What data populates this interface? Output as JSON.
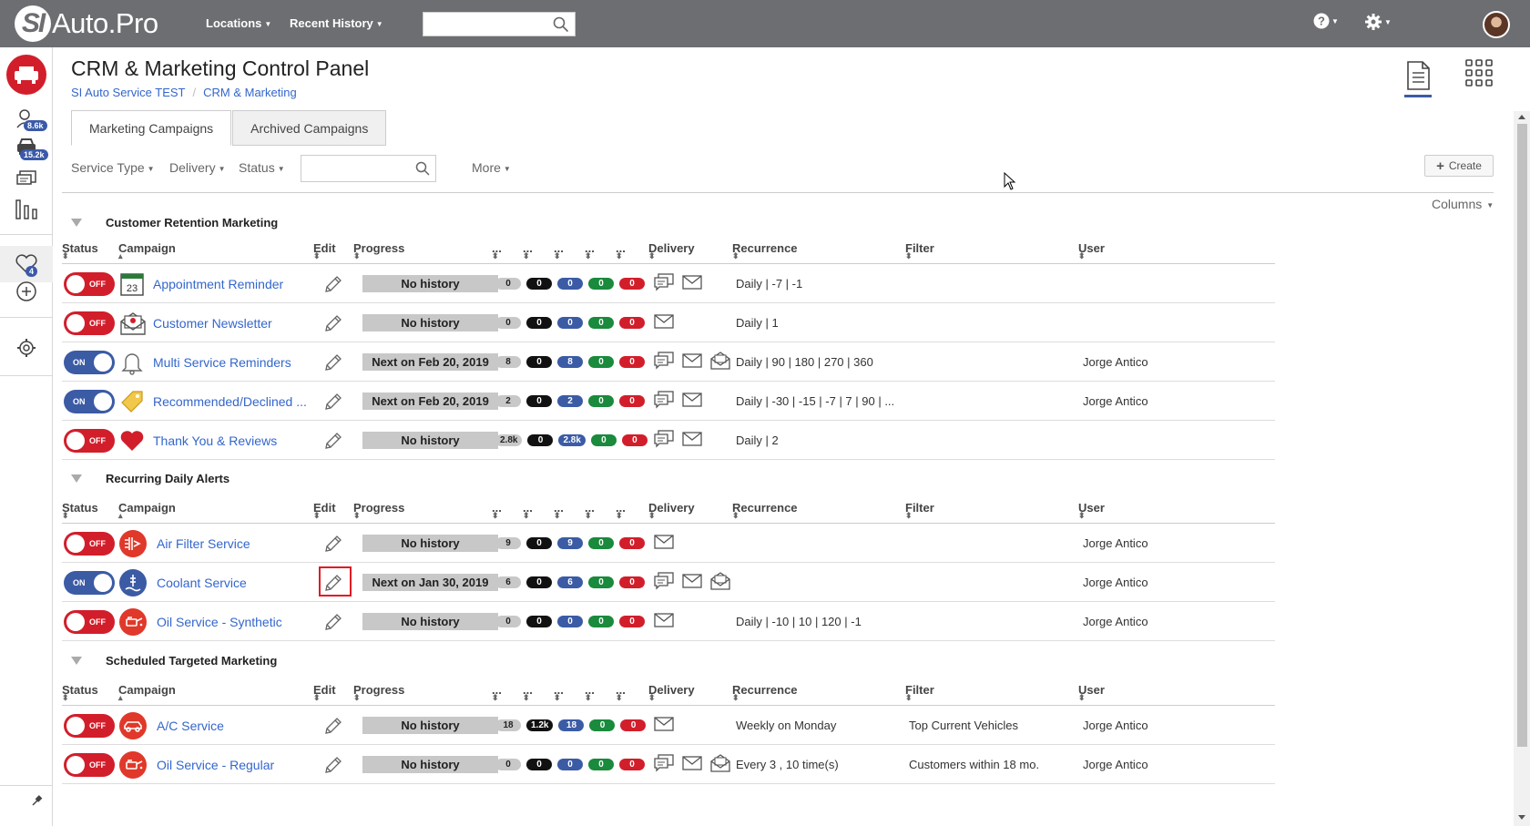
{
  "brand": {
    "logo_initials": "SI",
    "logo_text": "Auto.Pro"
  },
  "topnav": {
    "locations": "Locations",
    "recent_history": "Recent History"
  },
  "sidebar": {
    "badge_customers": "8.6k",
    "badge_vehicles": "15.2k",
    "badge_heart": "4"
  },
  "header": {
    "title": "CRM & Marketing Control Panel",
    "breadcrumb": [
      "SI Auto Service TEST",
      "CRM & Marketing"
    ]
  },
  "tabs": [
    "Marketing Campaigns",
    "Archived Campaigns"
  ],
  "filters": {
    "service_type": "Service Type",
    "delivery": "Delivery",
    "status": "Status",
    "more": "More",
    "create": "Create",
    "columns": "Columns"
  },
  "columns": {
    "status": "Status",
    "campaign": "Campaign",
    "edit": "Edit",
    "progress": "Progress",
    "dots": "...",
    "delivery": "Delivery",
    "recurrence": "Recurrence",
    "filter": "Filter",
    "user": "User"
  },
  "groups": [
    {
      "name": "Customer Retention Marketing",
      "rows": [
        {
          "status": "OFF",
          "icon": "calendar-icon",
          "name": "Appointment Reminder",
          "progress": "No history",
          "counts": [
            "0",
            "0",
            "0",
            "0",
            "0"
          ],
          "delivery": [
            "sms-icon",
            "email-icon"
          ],
          "recurrence": "Daily | -7 | -1",
          "filter": "",
          "user": ""
        },
        {
          "status": "OFF",
          "icon": "newsletter-icon",
          "name": "Customer Newsletter",
          "progress": "No history",
          "counts": [
            "0",
            "0",
            "0",
            "0",
            "0"
          ],
          "delivery": [
            "email-icon"
          ],
          "recurrence": "Daily | 1",
          "filter": "",
          "user": ""
        },
        {
          "status": "ON",
          "icon": "bell-icon",
          "name": "Multi Service Reminders",
          "progress": "Next on Feb 20, 2019",
          "counts": [
            "8",
            "0",
            "8",
            "0",
            "0"
          ],
          "delivery": [
            "sms-icon",
            "email-icon",
            "mail-icon"
          ],
          "recurrence": "Daily | 90 | 180 | 270 | 360",
          "filter": "",
          "user": "Jorge Antico"
        },
        {
          "status": "ON",
          "icon": "tag-icon",
          "name": "Recommended/Declined ...",
          "progress": "Next on Feb 20, 2019",
          "counts": [
            "2",
            "0",
            "2",
            "0",
            "0"
          ],
          "delivery": [
            "sms-icon",
            "email-icon"
          ],
          "recurrence": "Daily | -30 | -15 | -7 | 7 | 90 | ...",
          "filter": "",
          "user": "Jorge Antico"
        },
        {
          "status": "OFF",
          "icon": "heart-icon",
          "name": "Thank You & Reviews",
          "progress": "No history",
          "counts": [
            "2.8k",
            "0",
            "2.8k",
            "0",
            "0"
          ],
          "delivery": [
            "sms-icon",
            "email-icon"
          ],
          "recurrence": "Daily | 2",
          "filter": "",
          "user": ""
        }
      ]
    },
    {
      "name": "Recurring Daily Alerts",
      "rows": [
        {
          "status": "OFF",
          "icon": "air-filter-icon",
          "name": "Air Filter Service",
          "progress": "No history",
          "counts": [
            "9",
            "0",
            "9",
            "0",
            "0"
          ],
          "delivery": [
            "email-icon"
          ],
          "recurrence": "",
          "filter": "",
          "user": "Jorge Antico"
        },
        {
          "status": "ON",
          "icon": "coolant-icon",
          "name": "Coolant Service",
          "progress": "Next on Jan 30, 2019",
          "counts": [
            "6",
            "0",
            "6",
            "0",
            "0"
          ],
          "delivery": [
            "sms-icon",
            "email-icon",
            "mail-icon"
          ],
          "recurrence": "",
          "filter": "",
          "user": "Jorge Antico"
        },
        {
          "status": "OFF",
          "icon": "oil-can-icon",
          "name": "Oil Service - Synthetic",
          "progress": "No history",
          "counts": [
            "0",
            "0",
            "0",
            "0",
            "0"
          ],
          "delivery": [
            "email-icon"
          ],
          "recurrence": "Daily | -10 | 10 | 120 | -1",
          "filter": "",
          "user": "Jorge Antico"
        }
      ]
    },
    {
      "name": "Scheduled Targeted Marketing",
      "rows": [
        {
          "status": "OFF",
          "icon": "car-ac-icon",
          "name": "A/C Service",
          "progress": "No history",
          "counts": [
            "18",
            "1.2k",
            "18",
            "0",
            "0"
          ],
          "delivery": [
            "email-icon"
          ],
          "recurrence": "Weekly on Monday",
          "filter": "Top Current Vehicles",
          "user": "Jorge Antico"
        },
        {
          "status": "OFF",
          "icon": "oil-can-icon",
          "name": "Oil Service - Regular",
          "progress": "No history",
          "counts": [
            "0",
            "0",
            "0",
            "0",
            "0"
          ],
          "delivery": [
            "sms-icon",
            "email-icon",
            "mail-icon"
          ],
          "recurrence": "Every 3 , 10 time(s)",
          "filter": "Customers within 18 mo.",
          "user": "Jorge Antico"
        }
      ]
    }
  ]
}
